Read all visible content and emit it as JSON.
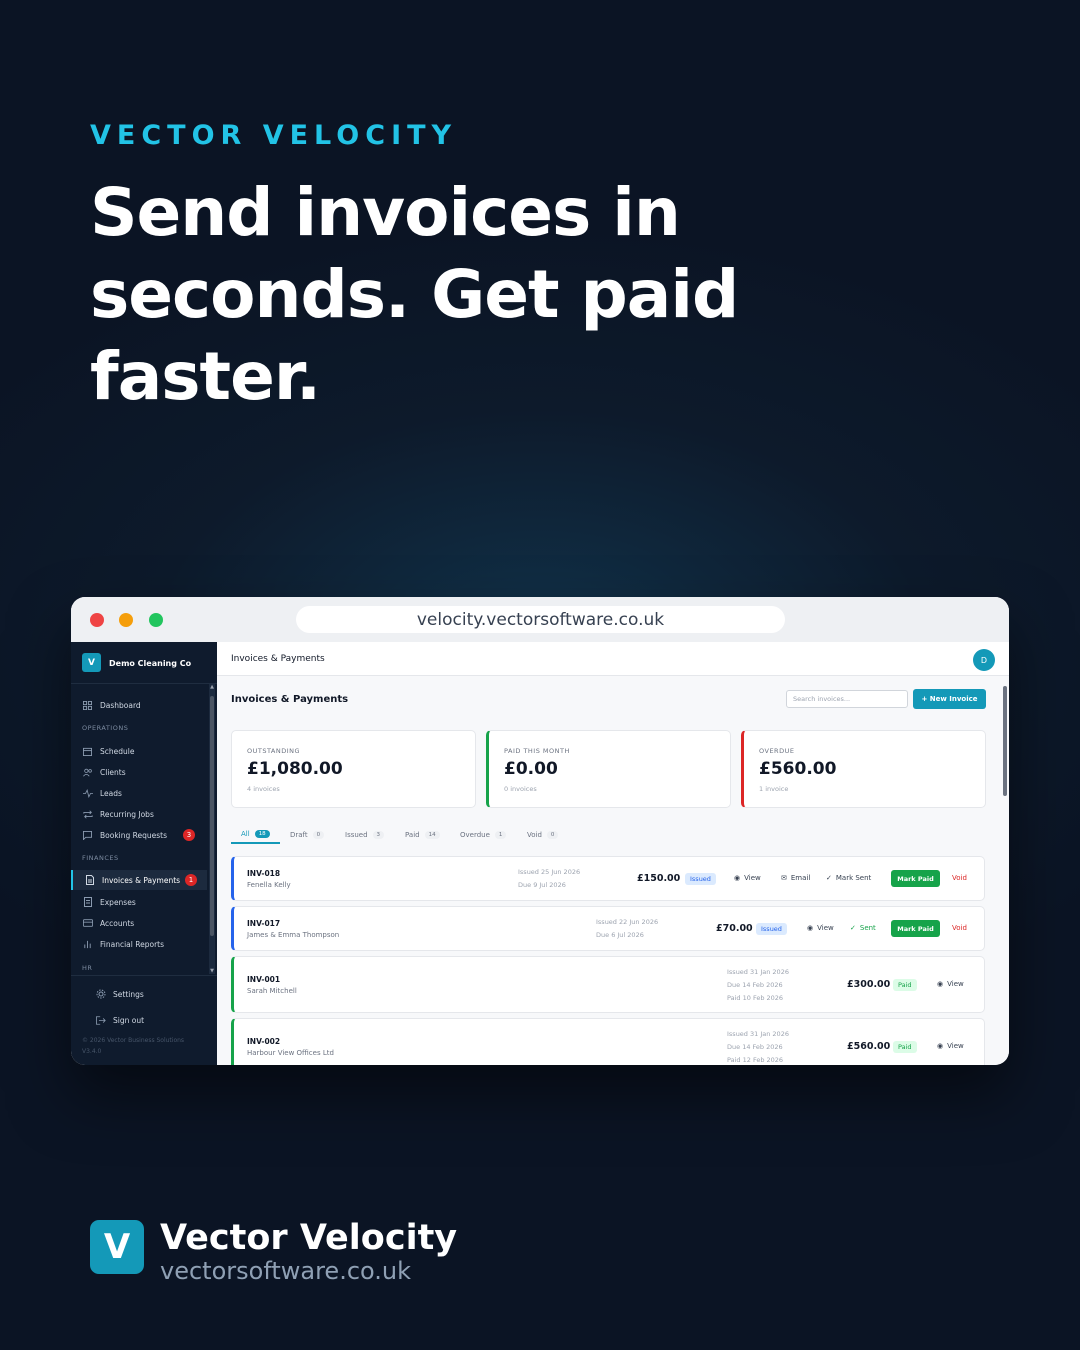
{
  "hero": {
    "kicker": "VECTOR VELOCITY",
    "headline": "Send invoices in seconds. Get paid faster."
  },
  "browser": {
    "url": "velocity.vectorsoftware.co.uk"
  },
  "sidebar": {
    "logo_letter": "V",
    "company": "Demo Cleaning Co",
    "dashboard": "Dashboard",
    "sections": {
      "operations": "OPERATIONS",
      "finances": "FINANCES",
      "hr": "HR"
    },
    "items": [
      {
        "label": "Schedule",
        "icon": "calendar-icon"
      },
      {
        "label": "Clients",
        "icon": "users-icon"
      },
      {
        "label": "Leads",
        "icon": "activity-icon"
      },
      {
        "label": "Recurring Jobs",
        "icon": "repeat-icon"
      },
      {
        "label": "Booking Requests",
        "icon": "message-icon",
        "badge": "3"
      },
      {
        "label": "Invoices & Payments",
        "icon": "document-icon",
        "badge": "1",
        "active": true
      },
      {
        "label": "Expenses",
        "icon": "receipt-icon"
      },
      {
        "label": "Accounts",
        "icon": "card-icon"
      },
      {
        "label": "Financial Reports",
        "icon": "bar-chart-icon"
      }
    ],
    "settings": "Settings",
    "signout": "Sign out",
    "copyright": "© 2026 Vector Business Solutions",
    "version": "V3.4.0"
  },
  "topbar": {
    "title": "Invoices & Payments",
    "avatar": "D"
  },
  "page": {
    "title": "Invoices & Payments",
    "search_placeholder": "Search invoices...",
    "new_invoice": "+ New Invoice"
  },
  "stats": [
    {
      "label": "OUTSTANDING",
      "value": "£1,080.00",
      "sub": "4 invoices"
    },
    {
      "label": "PAID THIS MONTH",
      "value": "£0.00",
      "sub": "0 invoices"
    },
    {
      "label": "OVERDUE",
      "value": "£560.00",
      "sub": "1 invoice"
    }
  ],
  "tabs": [
    {
      "label": "All",
      "count": "18"
    },
    {
      "label": "Draft",
      "count": "0"
    },
    {
      "label": "Issued",
      "count": "3"
    },
    {
      "label": "Paid",
      "count": "14"
    },
    {
      "label": "Overdue",
      "count": "1"
    },
    {
      "label": "Void",
      "count": "0"
    }
  ],
  "actions": {
    "view": "View",
    "email": "Email",
    "mark_sent": "Mark Sent",
    "sent": "Sent",
    "mark_paid": "Mark Paid",
    "void": "Void"
  },
  "invoices": [
    {
      "number": "INV-018",
      "client": "Fenella Kelly",
      "issued": "Issued 25 Jun 2026",
      "due": "Due 9 Jul 2026",
      "amount": "£150.00",
      "status": "Issued"
    },
    {
      "number": "INV-017",
      "client": "James & Emma Thompson",
      "issued": "Issued 22 Jun 2026",
      "due": "Due 6 Jul 2026",
      "amount": "£70.00",
      "status": "Issued"
    },
    {
      "number": "INV-001",
      "client": "Sarah Mitchell",
      "issued": "Issued 31 Jan 2026",
      "due": "Due 14 Feb 2026",
      "paid": "Paid 10 Feb 2026",
      "amount": "£300.00",
      "status": "Paid"
    },
    {
      "number": "INV-002",
      "client": "Harbour View Offices Ltd",
      "issued": "Issued 31 Jan 2026",
      "due": "Due 14 Feb 2026",
      "paid": "Paid 12 Feb 2026",
      "amount": "£560.00",
      "status": "Paid"
    }
  ],
  "footer": {
    "logo_letter": "V",
    "name": "Vector Velocity",
    "url": "vectorsoftware.co.uk"
  },
  "colors": {
    "accent": "#1499b8",
    "kicker": "#22c3e6",
    "background": "#0d1a2b",
    "paid_green": "#16a34a",
    "overdue_red": "#dc2626",
    "issued_blue": "#2563eb"
  }
}
